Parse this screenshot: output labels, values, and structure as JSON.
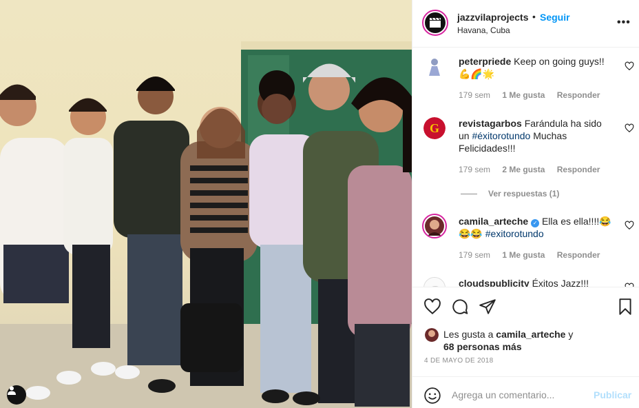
{
  "post": {
    "photo_alt": "Group photo of seven people",
    "user_tag_icon": "person-icon"
  },
  "header": {
    "username": "jazzvilaprojects",
    "separator": "•",
    "follow_label": "Seguir",
    "location": "Havana, Cuba",
    "more_icon": "•••"
  },
  "comments": [
    {
      "username": "peterpriede",
      "text": "Keep on going guys!! 💪🌈🌟",
      "time": "179 sem",
      "likes": "1 Me gusta",
      "reply_label": "Responder"
    },
    {
      "username": "revistagarbos",
      "text_before": "Farándula ha sido un ",
      "hashtag": "#éxitorotundo",
      "text_after": " Muchas Felicidades!!!",
      "time": "179 sem",
      "likes": "2 Me gusta",
      "reply_label": "Responder"
    },
    {
      "username": "camila_arteche",
      "text_before": "Ella es ella!!!!😂😂😂 ",
      "hashtag": "#exitorotundo",
      "time": "179 sem",
      "likes": "1 Me gusta",
      "reply_label": "Responder"
    },
    {
      "username": "cloudspublicity",
      "text": "Éxitos Jazz!!!"
    }
  ],
  "view_replies": "Ver respuestas (1)",
  "likes": {
    "prefix": "Les gusta a ",
    "user": "camila_arteche",
    "connector": " y",
    "others": "68 personas más"
  },
  "date": "4 DE MAYO DE 2018",
  "add_comment": {
    "placeholder": "Agrega un comentario...",
    "publish_label": "Publicar"
  },
  "colors": {
    "accent_blue": "#0095f6",
    "muted_text": "#8e8e8e",
    "publish_disabled": "#b2dffc",
    "hashtag": "#00376b"
  }
}
